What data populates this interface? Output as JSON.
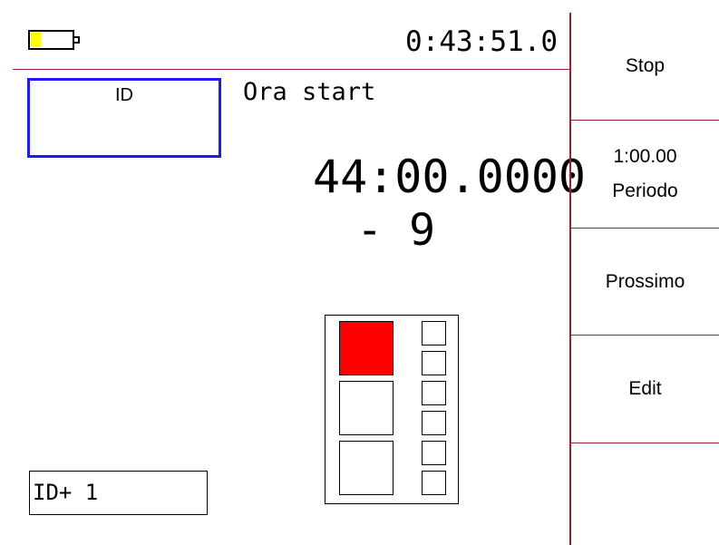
{
  "status": {
    "clock": "0:43:51.0",
    "battery_level": 0.25,
    "battery_color": "#ffff00"
  },
  "id_box": {
    "label": "ID",
    "border_color": "#1a1aff"
  },
  "ora_start_label": "Ora start",
  "start_time": "44:00.0000",
  "offset": "- 9",
  "slots": {
    "big": [
      {
        "filled": true
      },
      {
        "filled": false
      },
      {
        "filled": false
      }
    ],
    "small": [
      {
        "filled": false
      },
      {
        "filled": false
      },
      {
        "filled": false
      },
      {
        "filled": false
      },
      {
        "filled": false
      },
      {
        "filled": false
      }
    ],
    "fill_color": "#ff0000"
  },
  "id_plus": "ID+ 1",
  "sidebar": {
    "stop": "Stop",
    "periodo_value": "1:00.00",
    "periodo_label": "Periodo",
    "prossimo": "Prossimo",
    "edit": "Edit",
    "empty": ""
  },
  "accent_color": "#a02030"
}
